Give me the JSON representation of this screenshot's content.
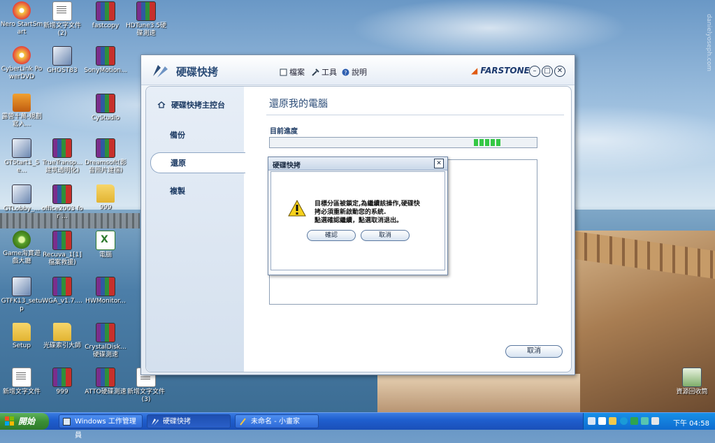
{
  "desktop": {
    "watermark": "danielyoseph.com",
    "icons": [
      {
        "label": "Nero StartSmart"
      },
      {
        "label": "新增文字文件 (2)"
      },
      {
        "label": "fastcopy"
      },
      {
        "label": "HDTune3.5硬碟測速"
      },
      {
        "label": "CyberLink PowerDVD"
      },
      {
        "label": "GHOST83"
      },
      {
        "label": "SonyMotion..."
      },
      {
        "label": "露營十萬-規劃寫入..."
      },
      {
        "label": "CyStudio"
      },
      {
        "label": "GTStart1_Se..."
      },
      {
        "label": "TrueTransp...建筑透明化)"
      },
      {
        "label": "Dreamsoft(影音照片建檔)"
      },
      {
        "label": "GTLobby_..."
      },
      {
        "label": "office2003 for ..."
      },
      {
        "label": "999"
      },
      {
        "label": "Game淘寶遊戲大廳"
      },
      {
        "label": "Recuva_1[1]檔案救援)"
      },
      {
        "label": "電腦"
      },
      {
        "label": "GTFK13_setup"
      },
      {
        "label": "WGA_v1.7...."
      },
      {
        "label": "HWMonitor..."
      },
      {
        "label": "Setup"
      },
      {
        "label": "光碟索引大師"
      },
      {
        "label": "CrystalDisk...硬碟測速"
      },
      {
        "label": "新增文字文件"
      },
      {
        "label": "999"
      },
      {
        "label": "ATTO硬碟測速"
      },
      {
        "label": "新增文字文件 (3)"
      }
    ],
    "recycle_bin": "資源回收筒"
  },
  "window": {
    "title": "硬碟快拷",
    "menu": {
      "file": "檔案",
      "tools": "工具",
      "help": "說明"
    },
    "brand": "FARSTONE",
    "sidebar": {
      "home": "硬碟快拷主控台",
      "items": [
        "備份",
        "還原",
        "複製"
      ],
      "active": "還原"
    },
    "main": {
      "title": "還原我的電腦",
      "progress_label": "目前進度",
      "cancel": "取消"
    }
  },
  "dialog": {
    "title": "硬碟快拷",
    "message_line1": "目標分區被鎖定,為繼續該操作,硬碟快",
    "message_line2": "拷必須重新啟動您的系統.",
    "message_line3": "點選確認繼續，點選取消退出。",
    "confirm": "確認",
    "cancel": "取消"
  },
  "taskbar": {
    "start": "開始",
    "tasks": [
      "Windows 工作管理員",
      "硬碟快拷",
      "未命名 - 小畫家"
    ],
    "clock": "下午 04:58"
  },
  "colors": {
    "accent": "#2c4d78",
    "progress": "#35c845",
    "taskbar": "#1f5fcf",
    "start": "#3a8f35"
  }
}
